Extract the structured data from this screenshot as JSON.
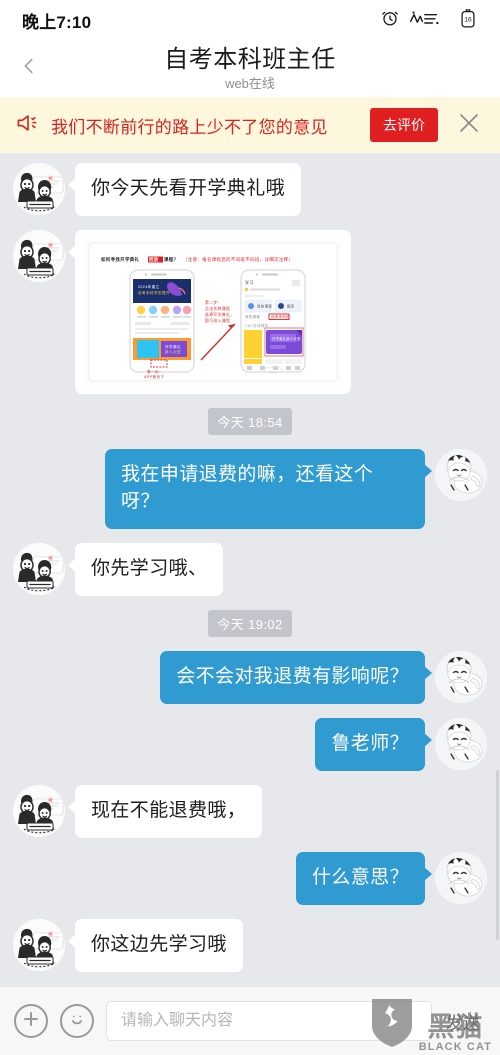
{
  "status_bar": {
    "time": "晚上7:10",
    "icons": [
      "alarm-clock-icon",
      "signal-pulse-icon",
      "battery-icon"
    ],
    "battery_level": "16"
  },
  "header": {
    "back_icon": "chevron-left-icon",
    "title": "自考本科班主任",
    "subtitle": "web在线"
  },
  "notice": {
    "icon": "megaphone-icon",
    "text": "我们不断前行的路上少不了您的意见",
    "button_label": "去评价",
    "close_icon": "close-icon",
    "bg_color": "#fcf7dd",
    "text_color": "#d9231f",
    "button_color": "#e02020"
  },
  "messages": [
    {
      "type": "text",
      "side": "in",
      "text": "你今天先看开学典礼哦",
      "avatar": "teacher-avatar"
    },
    {
      "type": "image",
      "side": "in",
      "avatar": "teacher-avatar",
      "image": {
        "alt": "开学典礼回放课程操作指引图",
        "caption": "如何寻找开学典礼回放课程？（注意：报名课程后的不同班不同班，详细见注释）",
        "step1": "第一步：APP首页下",
        "step2": "第二步：点击名称课程选择开学典礼，即可进入课程"
      }
    },
    {
      "type": "time",
      "text": "今天 18:54"
    },
    {
      "type": "text",
      "side": "out",
      "text": "我在申请退费的嘛，还看这个呀？",
      "avatar": "user-avatar"
    },
    {
      "type": "text",
      "side": "in",
      "text": "你先学习哦、",
      "avatar": "teacher-avatar"
    },
    {
      "type": "time",
      "text": "今天 19:02"
    },
    {
      "type": "text",
      "side": "out",
      "text": "会不会对我退费有影响呢？",
      "avatar": "user-avatar"
    },
    {
      "type": "text",
      "side": "out",
      "text": "鲁老师？",
      "avatar": "user-avatar"
    },
    {
      "type": "text",
      "side": "in",
      "text": "现在不能退费哦，",
      "avatar": "teacher-avatar"
    },
    {
      "type": "text",
      "side": "out",
      "text": "什么意思？",
      "avatar": "user-avatar"
    },
    {
      "type": "text",
      "side": "in",
      "text": "你这边先学习哦",
      "avatar": "teacher-avatar"
    }
  ],
  "input_bar": {
    "plus_icon": "plus-icon",
    "emoji_icon": "smiley-icon",
    "placeholder": "请输入聊天内容",
    "value": "",
    "send_label": "发送"
  },
  "watermark": {
    "shield_icon": "cat-shield-icon",
    "cn_text": "黑猫",
    "en_text": "BLACK CAT"
  },
  "colors": {
    "page_bg": "#e6e8ec",
    "out_bubble": "#2f9bd1",
    "in_bubble": "#ffffff",
    "timestamp_chip": "#c2c6cc"
  }
}
